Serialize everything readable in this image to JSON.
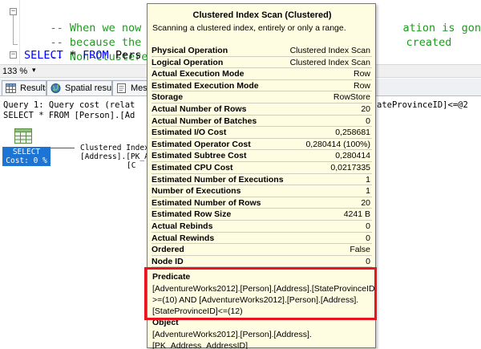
{
  "editor": {
    "lines": [
      {
        "comment": "-- When we now run",
        "rest": "ation is gone,"
      },
      {
        "comment": "-- because the Que",
        "rest": "created"
      },
      {
        "comment": "-- Non-Clustered I",
        "rest": ""
      }
    ],
    "select_line": {
      "keyword_select": "SELECT",
      "star": " * ",
      "keyword_from": "FROM",
      "rest": " Pers"
    }
  },
  "zoom": {
    "value": "133 %"
  },
  "tabs": [
    {
      "label": "Results",
      "icon": "grid-icon"
    },
    {
      "label": "Spatial results",
      "icon": "globe-icon"
    },
    {
      "label": "Mess",
      "icon": "message-icon"
    }
  ],
  "results": {
    "query_header": "Query 1: Query cost (relat",
    "query_header_right": "ateProvinceID]<=@2",
    "query_sql": "SELECT * FROM [Person].[Ad",
    "select_node": {
      "line1": "SELECT",
      "line2": "Cost: 0 %"
    },
    "plan_node": {
      "line1": "Clustered Index",
      "line2": "[Address].[PK_A",
      "line3": "[C"
    }
  },
  "tooltip": {
    "title": "Clustered Index Scan (Clustered)",
    "description": "Scanning a clustered index, entirely or only a range.",
    "rows": [
      {
        "label": "Physical Operation",
        "value": "Clustered Index Scan"
      },
      {
        "label": "Logical Operation",
        "value": "Clustered Index Scan"
      },
      {
        "label": "Actual Execution Mode",
        "value": "Row"
      },
      {
        "label": "Estimated Execution Mode",
        "value": "Row"
      },
      {
        "label": "Storage",
        "value": "RowStore"
      },
      {
        "label": "Actual Number of Rows",
        "value": "20"
      },
      {
        "label": "Actual Number of Batches",
        "value": "0"
      },
      {
        "label": "Estimated I/O Cost",
        "value": "0,258681"
      },
      {
        "label": "Estimated Operator Cost",
        "value": "0,280414 (100%)"
      },
      {
        "label": "Estimated Subtree Cost",
        "value": "0,280414"
      },
      {
        "label": "Estimated CPU Cost",
        "value": "0,0217335"
      },
      {
        "label": "Estimated Number of Executions",
        "value": "1"
      },
      {
        "label": "Number of Executions",
        "value": "1"
      },
      {
        "label": "Estimated Number of Rows",
        "value": "20"
      },
      {
        "label": "Estimated Row Size",
        "value": "4241 B"
      },
      {
        "label": "Actual Rebinds",
        "value": "0"
      },
      {
        "label": "Actual Rewinds",
        "value": "0"
      },
      {
        "label": "Ordered",
        "value": "False"
      },
      {
        "label": "Node ID",
        "value": "0"
      }
    ],
    "predicate": {
      "title": "Predicate",
      "lines": [
        "[AdventureWorks2012].[Person].[Address].[StateProvinceID]",
        ">=(10) AND [AdventureWorks2012].[Person].[Address].",
        "[StateProvinceID]<=(12)"
      ]
    },
    "object": {
      "title": "Object",
      "lines": [
        "[AdventureWorks2012].[Person].[Address].",
        "[PK_Address_AddressID]"
      ]
    }
  },
  "colors": {
    "comment": "#1e9a1e",
    "keyword": "#0000ff",
    "tooltip_bg": "#fffde1",
    "select_node_bg": "#1c74d4",
    "highlight": "#e8141f"
  }
}
